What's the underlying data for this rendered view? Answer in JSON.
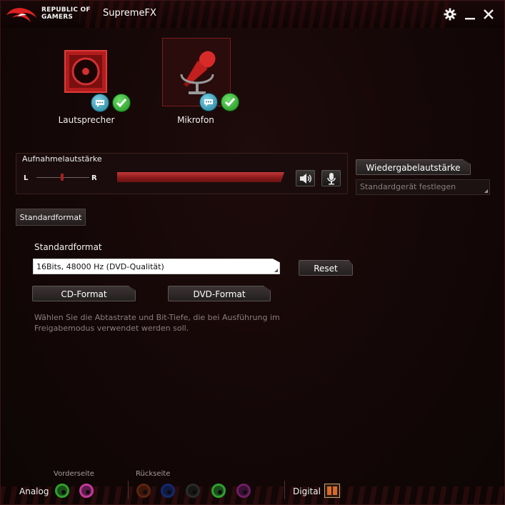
{
  "window": {
    "brand_line1": "REPUBLIC OF",
    "brand_line2": "GAMERS",
    "title": "SupremeFX",
    "icons": [
      "rog-logo-icon",
      "gear-icon",
      "minimize-icon",
      "close-icon"
    ]
  },
  "devices": [
    {
      "label": "Lautsprecher",
      "icon": "speaker-icon",
      "selected": false,
      "badges": [
        "chat-bubble-icon",
        "check-icon"
      ]
    },
    {
      "label": "Mikrofon",
      "icon": "microphone-icon",
      "selected": true,
      "badges": [
        "chat-bubble-icon",
        "check-icon"
      ]
    }
  ],
  "recording": {
    "title": "Aufnahmelautstärke",
    "left_label": "L",
    "right_label": "R",
    "balance": 0.5,
    "volume": 1.0,
    "icons": [
      "speaker-volume-icon",
      "microphone-small-icon"
    ]
  },
  "playback": {
    "button_label": "Wiedergabelautstärke",
    "default_device_placeholder": "Standardgerät festlegen"
  },
  "tabs": [
    {
      "label": "Standardformat",
      "active": true
    }
  ],
  "format": {
    "heading": "Standardformat",
    "selected": "16Bits, 48000 Hz (DVD-Qualität)",
    "reset_label": "Reset",
    "cd_label": "CD-Format",
    "dvd_label": "DVD-Format",
    "hint": "Wählen Sie die Abtastrate und Bit-Tiefe, die bei Ausführung im Freigabemodus verwendet werden soll."
  },
  "jacks": {
    "analog_label": "Analog",
    "front_label": "Vorderseite",
    "rear_label": "Rückseite",
    "digital_label": "Digital",
    "front_colors": [
      "#2ea02e",
      "#c43a9a"
    ],
    "rear_colors": [
      "#8a3a1a",
      "#1e3a9a",
      "#2a2a2a",
      "#2ea02e",
      "#8a2a7a"
    ]
  },
  "colors": {
    "accent": "#c0262a",
    "background": "#140707"
  }
}
